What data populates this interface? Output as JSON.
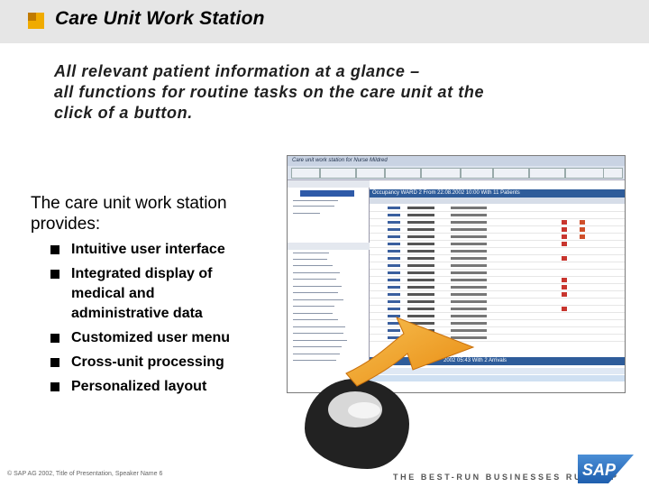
{
  "header": {
    "title": "Care Unit Work Station"
  },
  "intro": {
    "lines": [
      "All relevant patient information at a glance –",
      "all functions for routine tasks on the care unit at the",
      "click of a button."
    ]
  },
  "provides": {
    "lines": [
      "The care unit work station",
      "provides:"
    ]
  },
  "bullets": [
    {
      "lines": [
        "Intuitive user interface"
      ]
    },
    {
      "lines": [
        "Integrated display of",
        "medical and",
        "administrative data"
      ]
    },
    {
      "lines": [
        "Customized user menu"
      ]
    },
    {
      "lines": [
        "Cross-unit processing"
      ]
    },
    {
      "lines": [
        "Personalized layout"
      ]
    }
  ],
  "screenshot": {
    "window_title": "Care unit work station for Nurse Mildred",
    "occupancy_bar": "Occupancy WARD 2 From 22.08.2002 10:00 With 11 Patients",
    "arrivals_bar": "2002 05:43 With 2 Arrivals"
  },
  "footer": {
    "copyright": "© SAP AG 2002, Title of Presentation, Speaker Name 6",
    "tagline": "THE BEST-RUN BUSINESSES RUN SAP",
    "logo_text": "SAP"
  },
  "colors": {
    "accent": "#f0ab00",
    "arrow": "#f0a020",
    "logo_blue": "#1f66b3"
  }
}
